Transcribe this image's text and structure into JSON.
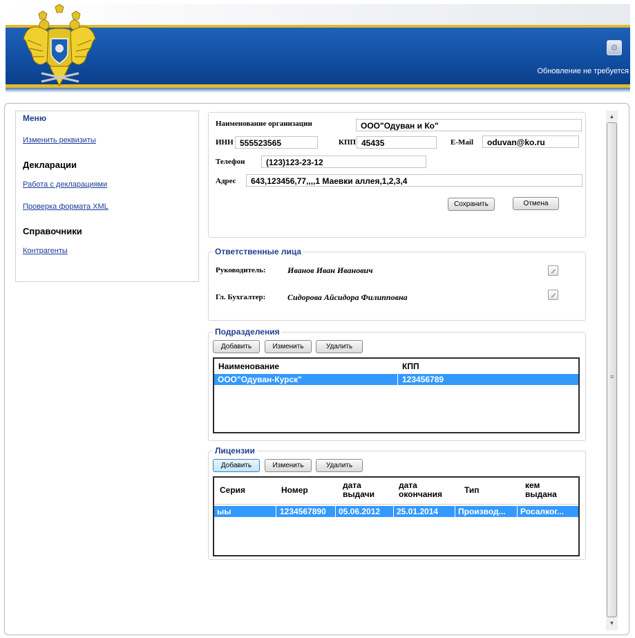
{
  "header": {
    "update_status": "Обновление не требуется",
    "update_icon": "settings-gear-icon",
    "emblem_icon": "double-headed-eagle-emblem"
  },
  "sidebar": {
    "menu_title": "Меню",
    "edit_requisites": "Изменить реквизиты",
    "declarations_title": "Декларации",
    "work_with_declarations": "Работа с декларациями",
    "xml_check": "Проверка формата XML",
    "references_title": "Справочники",
    "counterparties": "Контрагенты"
  },
  "organization": {
    "name_label": "Наименование организации",
    "name_value": "ООО\"Одуван и Ко\"",
    "inn_label": "ИНН",
    "inn_value": "555523565",
    "kpp_label": "КПП",
    "kpp_value": "45435",
    "email_label": "E-Mail",
    "email_value": "oduvan@ko.ru",
    "phone_label": "Телефон",
    "phone_value": "(123)123-23-12",
    "address_label": "Адрес",
    "address_value": "643,123456,77,,,,1 Маевки аллея,1,2,3,4",
    "save_label": "Сохранить",
    "cancel_label": "Отмена"
  },
  "responsible": {
    "title": "Ответственные лица",
    "director_label": "Руководитель:",
    "director_value": "Иванов Иван Иванович",
    "accountant_label": "Гл. Бухгалтер:",
    "accountant_value": "Сидорова Айсидора Филипповна"
  },
  "divisions": {
    "title": "Подразделения",
    "add_label": "Добавить",
    "edit_label": "Изменить",
    "delete_label": "Удалить",
    "columns": [
      "Наименование",
      "КПП"
    ],
    "rows": [
      [
        "ООО\"Одуван-Курск\"",
        "123456789"
      ]
    ]
  },
  "licenses": {
    "title": "Лицензии",
    "add_label": "Добавить",
    "edit_label": "Изменить",
    "delete_label": "Удалить",
    "columns": [
      [
        "Серия",
        ""
      ],
      [
        "Номер",
        ""
      ],
      [
        "дата",
        "выдачи"
      ],
      [
        "дата",
        "окончания"
      ],
      [
        "Тип",
        ""
      ],
      [
        "кем",
        "выдана"
      ]
    ],
    "rows": [
      [
        "ыы",
        "1234567890",
        "05.06.2012",
        "25.01.2014",
        "Производ...",
        "Росалког..."
      ]
    ]
  },
  "colors": {
    "header_blue": "#1353a8",
    "header_gold": "#e3bb2e",
    "selection": "#3399ff",
    "group_title": "#1f3f8f",
    "link": "#1a3b98"
  }
}
